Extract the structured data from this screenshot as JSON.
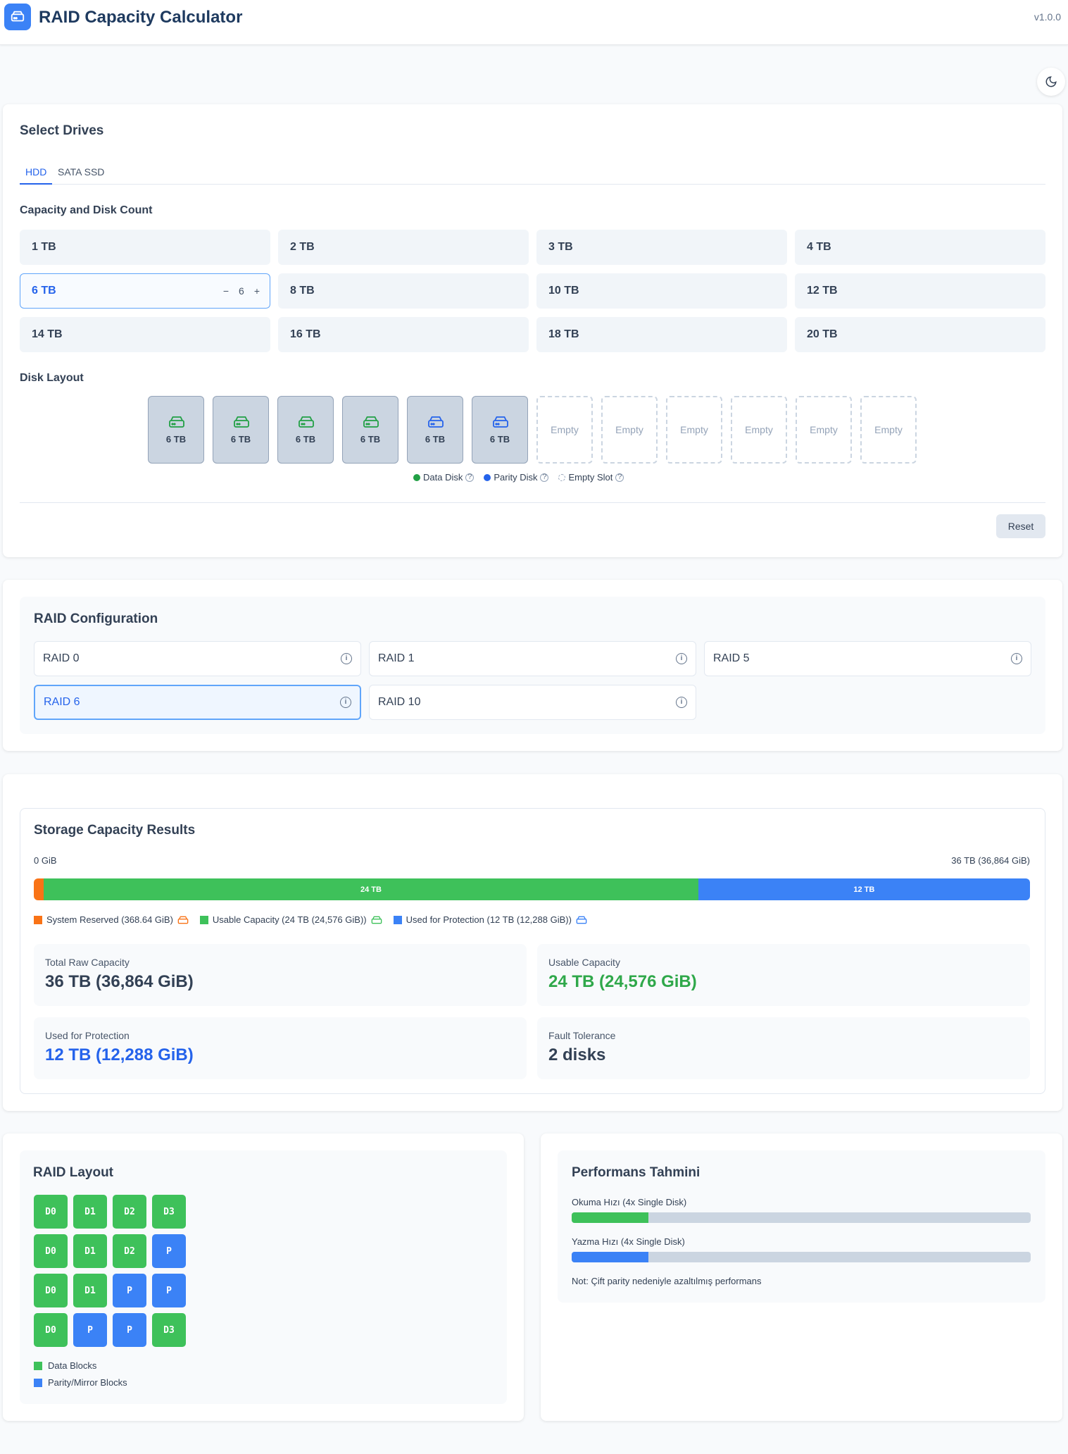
{
  "header": {
    "title": "RAID Capacity Calculator",
    "version": "v1.0.0"
  },
  "drives": {
    "title": "Select Drives",
    "tabs": [
      "HDD",
      "SATA SSD"
    ],
    "capacity_label": "Capacity and Disk Count",
    "capacities": [
      "1 TB",
      "2 TB",
      "3 TB",
      "4 TB",
      "6 TB",
      "8 TB",
      "10 TB",
      "12 TB",
      "14 TB",
      "16 TB",
      "18 TB",
      "20 TB"
    ],
    "selected_count": "6",
    "stepper_minus": "−",
    "stepper_plus": "+",
    "layout_label": "Disk Layout",
    "slots": [
      {
        "label": "6 TB",
        "type": "data"
      },
      {
        "label": "6 TB",
        "type": "data"
      },
      {
        "label": "6 TB",
        "type": "data"
      },
      {
        "label": "6 TB",
        "type": "data"
      },
      {
        "label": "6 TB",
        "type": "parity"
      },
      {
        "label": "6 TB",
        "type": "parity"
      },
      {
        "label": "Empty",
        "type": "empty"
      },
      {
        "label": "Empty",
        "type": "empty"
      },
      {
        "label": "Empty",
        "type": "empty"
      },
      {
        "label": "Empty",
        "type": "empty"
      },
      {
        "label": "Empty",
        "type": "empty"
      },
      {
        "label": "Empty",
        "type": "empty"
      }
    ],
    "legend": {
      "data": "Data Disk",
      "parity": "Parity Disk",
      "empty": "Empty Slot",
      "help": "?"
    },
    "reset": "Reset"
  },
  "raid_config": {
    "title": "RAID Configuration",
    "options": [
      "RAID 0",
      "RAID 1",
      "RAID 5",
      "RAID 6",
      "RAID 10"
    ],
    "info": "i"
  },
  "results": {
    "title": "Storage Capacity Results",
    "scale_min": "0 GiB",
    "scale_max": "36 TB (36,864 GiB)",
    "bar": {
      "reserved_fraction": 0.01,
      "usable_fraction": 0.657,
      "protection_fraction": 0.333,
      "usable_label": "24 TB",
      "protection_label": "12 TB"
    },
    "legend": {
      "reserved": "System Reserved (368.64 GiB)",
      "usable": "Usable Capacity (24 TB (24,576 GiB))",
      "protection": "Used for Protection (12 TB (12,288 GiB))"
    },
    "stats": {
      "raw_label": "Total Raw Capacity",
      "raw_value": "36 TB (36,864 GiB)",
      "usable_label": "Usable Capacity",
      "usable_value": "24 TB (24,576 GiB)",
      "protection_label": "Used for Protection",
      "protection_value": "12 TB (12,288 GiB)",
      "fault_label": "Fault Tolerance",
      "fault_value": "2 disks"
    }
  },
  "raid_layout": {
    "title": "RAID Layout",
    "rows": [
      [
        "D0",
        "D1",
        "D2",
        "D3"
      ],
      [
        "D0",
        "D1",
        "D2",
        "P"
      ],
      [
        "D0",
        "D1",
        "P",
        "P"
      ],
      [
        "D0",
        "P",
        "P",
        "D3"
      ]
    ],
    "legend_data": "Data Blocks",
    "legend_parity": "Parity/Mirror Blocks"
  },
  "performance": {
    "title": "Performans Tahmini",
    "read_label": "Okuma Hızı (4x Single Disk)",
    "read_fraction": 0.167,
    "write_label": "Yazma Hızı (4x Single Disk)",
    "write_fraction": 0.167,
    "note": "Not: Çift parity nedeniyle azaltılmış performans"
  },
  "colors": {
    "data": "#3ec15a",
    "parity": "#3b82f6",
    "reserved": "#f97316",
    "accent": "#2563eb"
  }
}
